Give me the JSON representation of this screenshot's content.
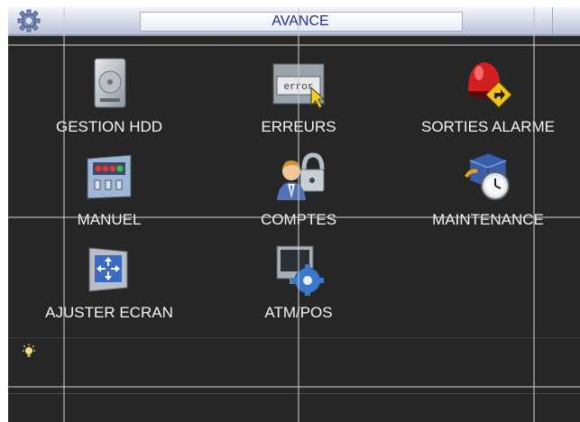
{
  "window": {
    "title": "AVANCE",
    "title_icon": "gear-icon"
  },
  "menu": {
    "items": [
      {
        "label": "GESTION HDD",
        "icon": "hard-disk-icon"
      },
      {
        "label": "ERREURS",
        "icon": "error-icon"
      },
      {
        "label": "SORTIES ALARME",
        "icon": "alarm-output-icon"
      },
      {
        "label": "MANUEL",
        "icon": "manual-record-icon"
      },
      {
        "label": "COMPTES",
        "icon": "user-accounts-icon"
      },
      {
        "label": "MAINTENANCE",
        "icon": "maintenance-icon"
      },
      {
        "label": "AJUSTER ECRAN",
        "icon": "screen-adjust-icon"
      },
      {
        "label": "ATM/POS",
        "icon": "atm-pos-icon"
      }
    ],
    "error_icon_text": "error"
  },
  "tip": {
    "icon": "lightbulb-icon",
    "text": ""
  },
  "colors": {
    "background": "#262626",
    "titlebar": "#d2d9e8",
    "title_text": "#1e2f8a",
    "label_text": "#f4f4f4"
  }
}
